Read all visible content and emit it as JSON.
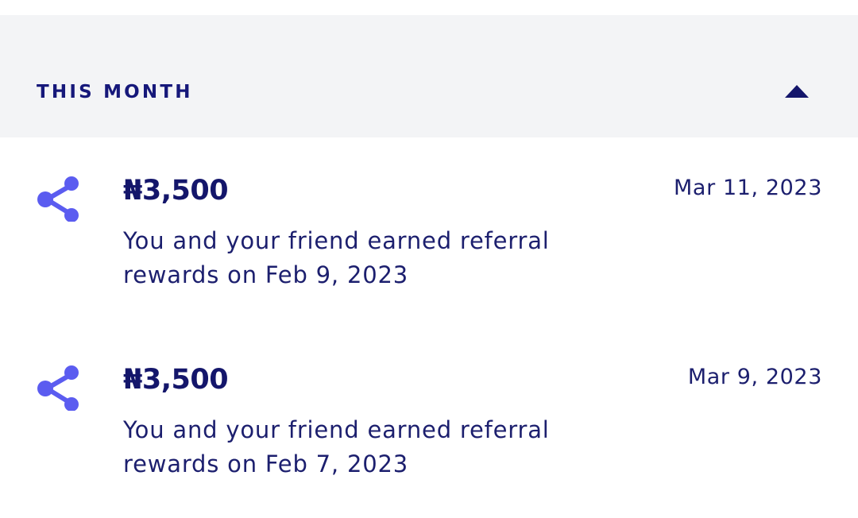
{
  "section": {
    "title": "THIS MONTH",
    "toggle_icon": "triangle-up-icon"
  },
  "colors": {
    "header_bg": "#f3f4f6",
    "text_primary": "#14166b",
    "icon_accent": "#5b5cf0"
  },
  "rewards": [
    {
      "icon": "share-icon",
      "amount": "₦3,500",
      "date": "Mar 11, 2023",
      "description": "You and your friend earned referral rewards on Feb 9, 2023"
    },
    {
      "icon": "share-icon",
      "amount": "₦3,500",
      "date": "Mar 9, 2023",
      "description": "You and your friend earned referral rewards on Feb 7, 2023"
    }
  ]
}
